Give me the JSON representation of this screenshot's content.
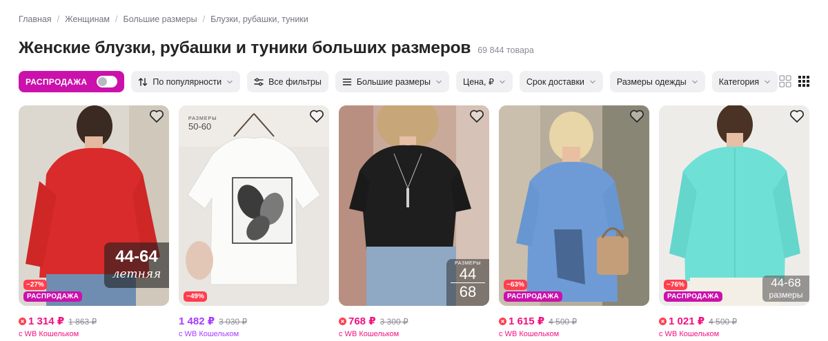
{
  "breadcrumb": [
    "Главная",
    "Женщинам",
    "Большие размеры",
    "Блузки, рубашки, туники"
  ],
  "title": "Женские блузки, рубашки и туники больших размеров",
  "count": "69 844 товара",
  "filters": {
    "sale": "РАСПРОДАЖА",
    "sort": "По популярности",
    "all_filters": "Все фильтры",
    "big_sizes": "Большие размеры",
    "price": "Цена, ₽",
    "delivery": "Срок доставки",
    "clothing_sizes": "Размеры одежды",
    "category": "Категория"
  },
  "colors": {
    "accent": "#cb11ab",
    "price_pink": "#f1117e",
    "price_purple": "#a73afd",
    "discount_red": "#ff3e4d"
  },
  "products": [
    {
      "discount": "−27%",
      "sale": "РАСПРОДАЖА",
      "price": "1 314 ₽",
      "old_price": "1 863 ₽",
      "wallet_note": "с WB Кошельком",
      "overlay_top": "44-64",
      "overlay_bottom": "летняя"
    },
    {
      "discount": "−49%",
      "price": "1 482 ₽",
      "old_price": "3 030 ₽",
      "wallet_note": "с WB Кошельком",
      "overlay_top": "РАЗМЕРЫ",
      "overlay_bottom": "50-60"
    },
    {
      "price": "768 ₽",
      "old_price": "3 300 ₽",
      "wallet_note": "с WB Кошельком",
      "overlay_label": "РАЗМЕРЫ",
      "overlay_top": "44",
      "overlay_bottom": "68"
    },
    {
      "discount": "−63%",
      "sale": "РАСПРОДАЖА",
      "price": "1 615 ₽",
      "old_price": "4 500 ₽",
      "wallet_note": "с WB Кошельком"
    },
    {
      "discount": "−76%",
      "sale": "РАСПРОДАЖА",
      "price": "1 021 ₽",
      "old_price": "4 500 ₽",
      "wallet_note": "с WB Кошельком",
      "overlay_top": "44-68",
      "overlay_bottom": "размеры"
    }
  ]
}
